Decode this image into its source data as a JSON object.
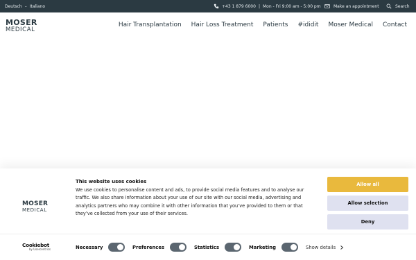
{
  "topbar": {
    "languages": [
      "Deutsch",
      "Italiano"
    ],
    "language_sep": "–",
    "phone": "+43 1 879 6000",
    "sep": "|",
    "hours": "Mon - Fri 9:00 am - 5:00 pm",
    "appointment": "Make an appointment",
    "search": "Search"
  },
  "logo": {
    "line1": "MOSER",
    "line2": "MEDICAL"
  },
  "nav": [
    "Hair Transplantation",
    "Hair Loss Treatment",
    "Patients",
    "#ididit",
    "Moser Medical",
    "Contact"
  ],
  "cookie": {
    "title": "This website uses cookies",
    "body": "We use cookies to personalise content and ads, to provide social media features and to analyse our traffic. We also share information about your use of our site with our social media, advertising and analytics partners who may combine it with other information that you’ve provided to them or that they’ve collected from your use of their services.",
    "buttons": {
      "allow_all": "Allow all",
      "allow_selection": "Allow selection",
      "deny": "Deny"
    },
    "options": {
      "necessary": "Necessary",
      "preferences": "Preferences",
      "statistics": "Statistics",
      "marketing": "Marketing"
    },
    "show_details": "Show details",
    "cookiebot": {
      "name": "Cookiebot",
      "by": "by Usercentrics"
    }
  },
  "colors": {
    "topbar": "#2b3a42",
    "accent": "#e9b93d",
    "secondary_button": "#dfe1f0",
    "toggle": "#5b6670"
  }
}
